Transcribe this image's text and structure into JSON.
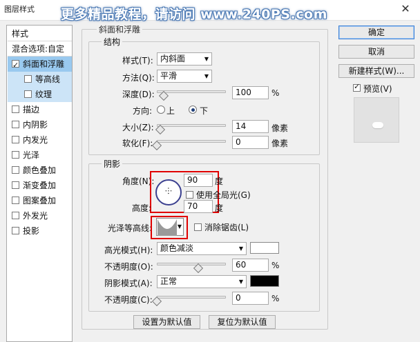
{
  "window": {
    "title": "图层样式",
    "close_glyph": "✕",
    "watermark": "更多精品教程，请访问 www.240PS.com"
  },
  "left_panel": {
    "items": [
      {
        "label": "样式",
        "checkbox": false,
        "checked": false
      },
      {
        "label": "混合选项:自定",
        "checkbox": false,
        "checked": false
      },
      {
        "label": "斜面和浮雕",
        "checkbox": true,
        "checked": true
      },
      {
        "label": "等高线",
        "checkbox": true,
        "checked": false
      },
      {
        "label": "纹理",
        "checkbox": true,
        "checked": false
      },
      {
        "label": "描边",
        "checkbox": true,
        "checked": false
      },
      {
        "label": "内阴影",
        "checkbox": true,
        "checked": false
      },
      {
        "label": "内发光",
        "checkbox": true,
        "checked": false
      },
      {
        "label": "光泽",
        "checkbox": true,
        "checked": false
      },
      {
        "label": "颜色叠加",
        "checkbox": true,
        "checked": false
      },
      {
        "label": "渐变叠加",
        "checkbox": true,
        "checked": false
      },
      {
        "label": "图案叠加",
        "checkbox": true,
        "checked": false
      },
      {
        "label": "外发光",
        "checkbox": true,
        "checked": false
      },
      {
        "label": "投影",
        "checkbox": true,
        "checked": false
      }
    ]
  },
  "bevel": {
    "section_title": "斜面和浮雕",
    "structure": {
      "title": "结构",
      "style_label": "样式(T):",
      "style_value": "内斜面",
      "method_label": "方法(Q):",
      "method_value": "平滑",
      "depth_label": "深度(D):",
      "depth_value": "100",
      "depth_unit": "%",
      "depth_level": 0.1,
      "direction_label": "方向:",
      "direction_up": "上",
      "direction_down": "下",
      "direction_selected": "下",
      "size_label": "大小(Z):",
      "size_value": "14",
      "size_unit": "像素",
      "size_level": 0.05,
      "soften_label": "软化(F):",
      "soften_value": "0",
      "soften_unit": "像素",
      "soften_level": 0.0
    },
    "shading": {
      "title": "阴影",
      "angle_label": "角度(N):",
      "angle_value": "90",
      "angle_unit": "度",
      "global_light_label": "使用全局光(G)",
      "global_light_checked": false,
      "altitude_label": "高度:",
      "altitude_value": "70",
      "altitude_unit": "度",
      "gloss_contour_label": "光泽等高线:",
      "anti_alias_label": "消除锯齿(L)",
      "anti_alias_checked": false,
      "highlight_mode_label": "高光模式(H):",
      "highlight_mode_value": "颜色减淡",
      "highlight_color": "#ffffff",
      "highlight_opacity_label": "不透明度(O):",
      "highlight_opacity_value": "60",
      "highlight_opacity_unit": "%",
      "highlight_opacity_level": 0.6,
      "shadow_mode_label": "阴影模式(A):",
      "shadow_mode_value": "正常",
      "shadow_color": "#000000",
      "shadow_opacity_label": "不透明度(C):",
      "shadow_opacity_value": "0",
      "shadow_opacity_unit": "%",
      "shadow_opacity_level": 0.0
    },
    "make_default_label": "设置为默认值",
    "reset_default_label": "复位为默认值"
  },
  "right_panel": {
    "ok_label": "确定",
    "cancel_label": "取消",
    "new_style_label": "新建样式(W)...",
    "preview_label": "预览(V)",
    "preview_checked": true
  },
  "colors": {
    "selected_item": "#99c9ef",
    "sub_item": "#cce4f7",
    "highlight_frame": "#e00000"
  }
}
